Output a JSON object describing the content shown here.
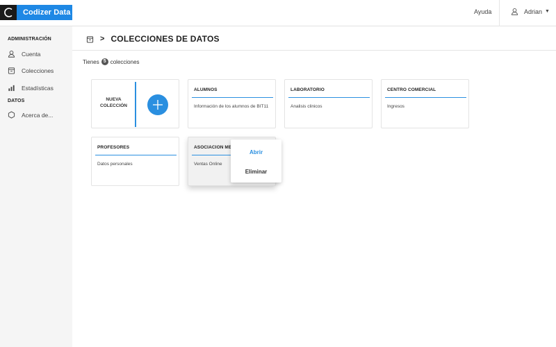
{
  "header": {
    "brand": "Codizer Data",
    "help": "Ayuda",
    "user": "Adrian"
  },
  "icons": {
    "brand_logo": "circle-arc-icon",
    "user": "user-icon",
    "account": "user-icon",
    "collections": "archive-icon",
    "stats": "bar-chart-icon",
    "about": "hexagon-icon",
    "add": "plus-icon"
  },
  "colors": {
    "accent": "#2a8fe0",
    "brand_bg": "#1e88e5",
    "logo_bg": "#1a1a1a",
    "sidebar_bg": "#f5f5f5"
  },
  "sidebar": {
    "section_admin": "ADMINISTRACIÓN",
    "section_data": "DATOS",
    "items": [
      {
        "label": "Cuenta"
      },
      {
        "label": "Colecciones"
      },
      {
        "label": "Estadísticas"
      },
      {
        "label": "Acerca de..."
      }
    ]
  },
  "page": {
    "arrow": ">",
    "title": "COLECCIONES DE DATOS",
    "summary_prefix": "Tienes",
    "count": "5",
    "summary_suffix": "colecciones"
  },
  "new_collection": {
    "line1": "NUEVA",
    "line2": "COLECCIÓN"
  },
  "collections": [
    {
      "title": "ALUMNOS",
      "description": "Información de los alumnos de BIT11"
    },
    {
      "title": "LABORATORIO",
      "description": "Analisis clinicos"
    },
    {
      "title": "CENTRO COMERCIAL",
      "description": "Ingresos"
    },
    {
      "title": "PROFESORES",
      "description": "Datos personales"
    },
    {
      "title": "ASOCIACIÓN ME",
      "description": "Ventas Online"
    }
  ],
  "context_menu": {
    "open": "Abrir",
    "delete": "Eliminar"
  }
}
